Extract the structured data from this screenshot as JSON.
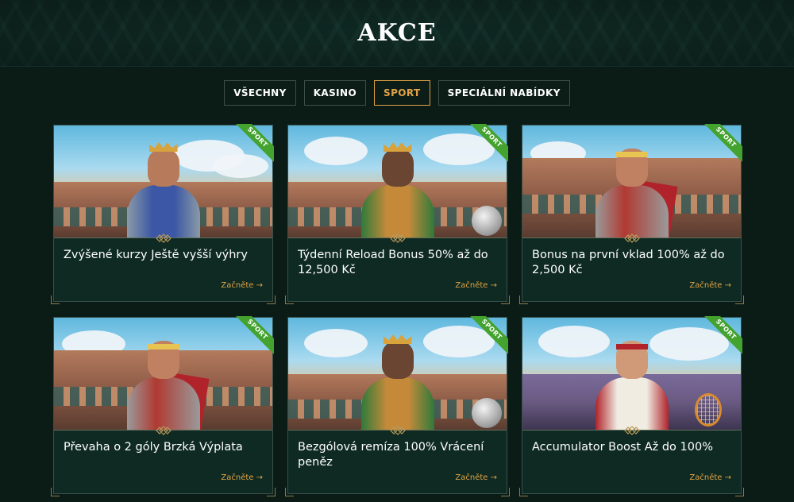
{
  "page": {
    "title": "AKCE"
  },
  "tabs": [
    {
      "label": "VŠECHNY",
      "active": false
    },
    {
      "label": "KASINO",
      "active": false
    },
    {
      "label": "SPORT",
      "active": true
    },
    {
      "label": "SPECIÁLNÍ NABÍDKY",
      "active": false
    }
  ],
  "colors": {
    "accent": "#e1a347",
    "badge": "#44a22f",
    "background": "#0b1c17"
  },
  "promotions": [
    {
      "badge": "SPORT",
      "title": "Zvýšené kurzy Ještě vyšší výhry",
      "cta": "Začněte →"
    },
    {
      "badge": "SPORT",
      "title": "Týdenní Reload Bonus 50% až do 12,500 Kč",
      "cta": "Začněte →"
    },
    {
      "badge": "SPORT",
      "title": "Bonus na první vklad 100% až do 2,500 Kč",
      "cta": "Začněte →"
    },
    {
      "badge": "SPORT",
      "title": "Převaha o 2 góly Brzká Výplata",
      "cta": "Začněte →"
    },
    {
      "badge": "SPORT",
      "title": "Bezgólová remíza 100% Vrácení peněz",
      "cta": "Začněte →"
    },
    {
      "badge": "SPORT",
      "title": "Accumulator Boost Až do 100%",
      "cta": "Začněte →"
    }
  ]
}
